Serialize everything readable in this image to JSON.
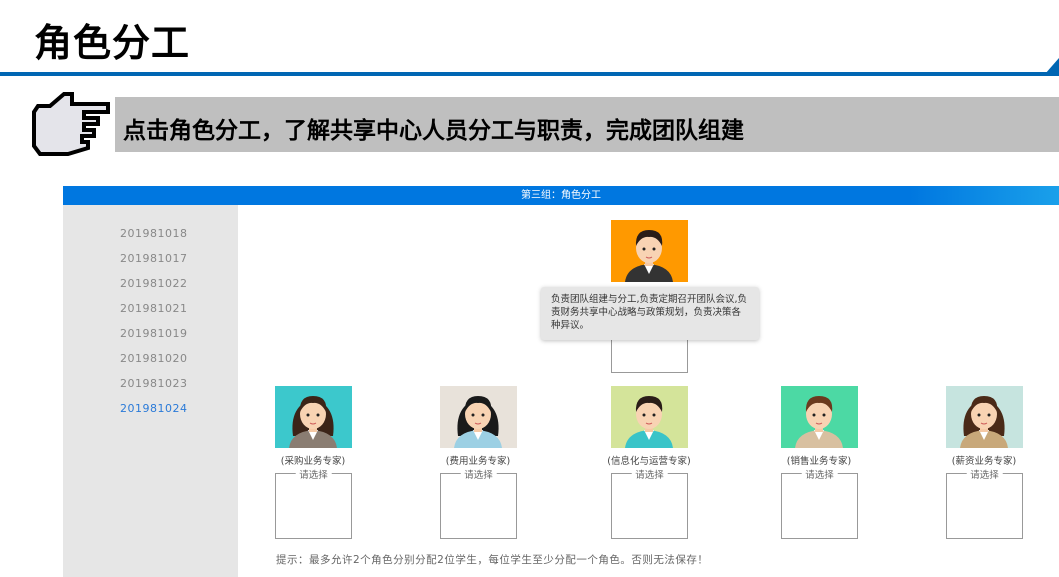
{
  "page_title": "角色分工",
  "instruction": "点击角色分工，了解共享中心人员分工与职责，完成团队组建",
  "panel": {
    "header": "第三组：角色分工",
    "students": [
      {
        "id": "201981018",
        "active": false
      },
      {
        "id": "201981017",
        "active": false
      },
      {
        "id": "201981022",
        "active": false
      },
      {
        "id": "201981021",
        "active": false
      },
      {
        "id": "201981019",
        "active": false
      },
      {
        "id": "201981020",
        "active": false
      },
      {
        "id": "201981023",
        "active": false
      },
      {
        "id": "201981024",
        "active": true
      }
    ],
    "leader": {
      "tooltip": "负责团队组建与分工,负责定期召开团队会议,负责财务共享中心战略与政策规划，负责决策各种异议。",
      "bg": "#ff9900"
    },
    "roles": [
      {
        "label": "(采购业务专家)",
        "placeholder": "请选择",
        "bg": "#3cc8cc"
      },
      {
        "label": "(费用业务专家)",
        "placeholder": "请选择",
        "bg": "#e8e2da"
      },
      {
        "label": "(信息化与运营专家)",
        "placeholder": "请选择",
        "bg": "#d4e49a"
      },
      {
        "label": "(销售业务专家)",
        "placeholder": "请选择",
        "bg": "#4cd9a4"
      },
      {
        "label": "(薪资业务专家)",
        "placeholder": "请选择",
        "bg": "#c6e4df"
      }
    ],
    "hint": "提示：最多允许2个角色分别分配2位学生，每位学生至少分配一个角色。否则无法保存！",
    "accent": "#0077e0"
  }
}
